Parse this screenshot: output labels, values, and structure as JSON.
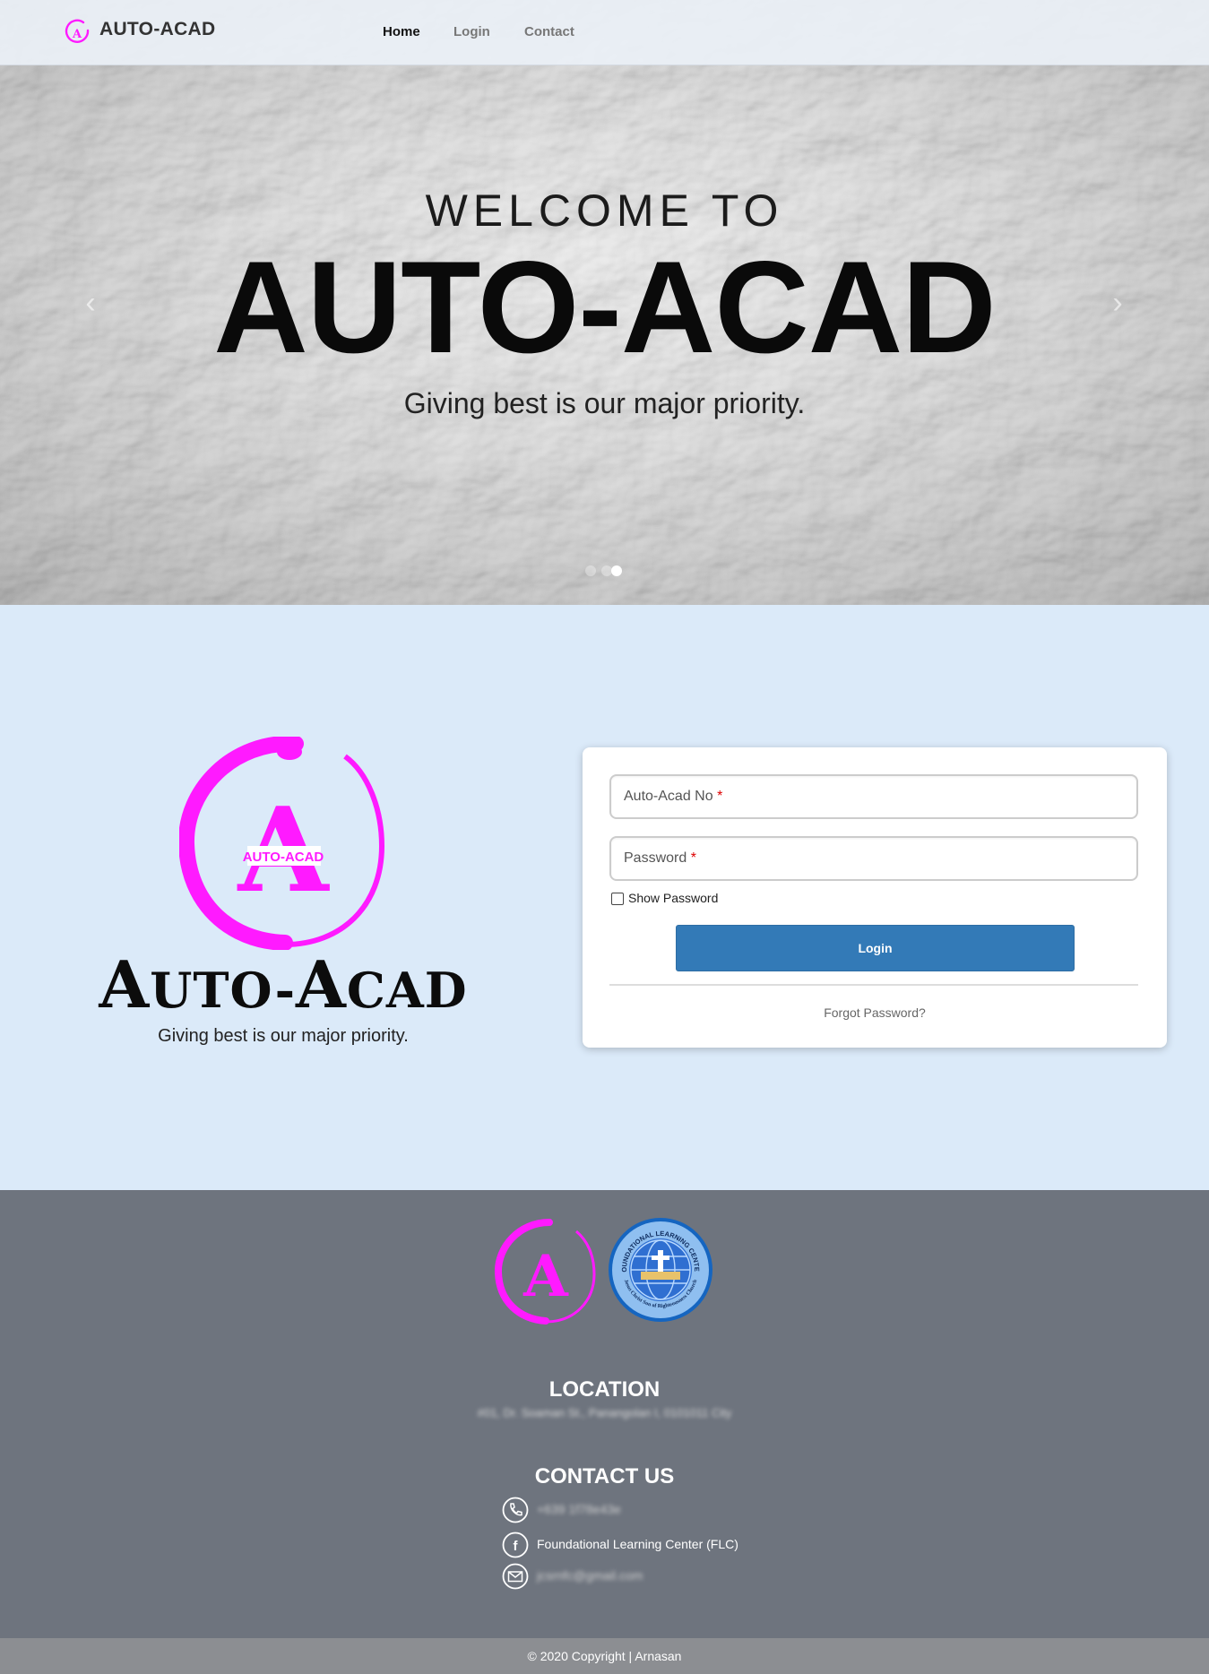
{
  "nav": {
    "brand": "AUTO-ACAD",
    "links": [
      {
        "label": "Home",
        "active": true
      },
      {
        "label": "Login",
        "active": false
      },
      {
        "label": "Contact",
        "active": false
      }
    ]
  },
  "hero": {
    "welcome": "WELCOME TO",
    "title": "AUTO-ACAD",
    "tagline": "Giving best is our major priority.",
    "prev_icon": "chevron-left-icon",
    "next_icon": "chevron-right-icon",
    "slide_count": 3,
    "active_slide": 3
  },
  "logo_section": {
    "logo_inner_text": "AUTO-ACAD",
    "logo_letter": "A",
    "wordmark_a1": "A",
    "wordmark_mid": "UTO-",
    "wordmark_a2": "A",
    "wordmark_end": "CAD",
    "tagline": "Giving best is our major priority."
  },
  "login_form": {
    "username_placeholder": "Auto-Acad No",
    "password_placeholder": "Password",
    "required_mark": "*",
    "show_password_label": "Show Password",
    "login_button": "Login",
    "forgot_password": "Forgot Password?"
  },
  "footer": {
    "location_heading": "LOCATION",
    "location_address": "#01, Dr. Soaman St., Panangolan I, 0101011 City",
    "contact_heading": "CONTACT US",
    "phone": "+639 1f78e43e",
    "facebook": "Foundational Learning Center (FLC)",
    "email": "jcsrnfc@gmail.com",
    "flc_seal_text_top": "FOUNDATIONAL LEARNING CENTER",
    "flc_seal_text_bottom": "Jesus Christ Son of Righteousness Church",
    "copyright": "© 2020 Copyright | Arnasan"
  },
  "colors": {
    "brand_magenta": "#ff1aff",
    "login_blue": "#337ab7",
    "page_bg": "#dbeaf9",
    "footer_bg": "#6e747e"
  }
}
